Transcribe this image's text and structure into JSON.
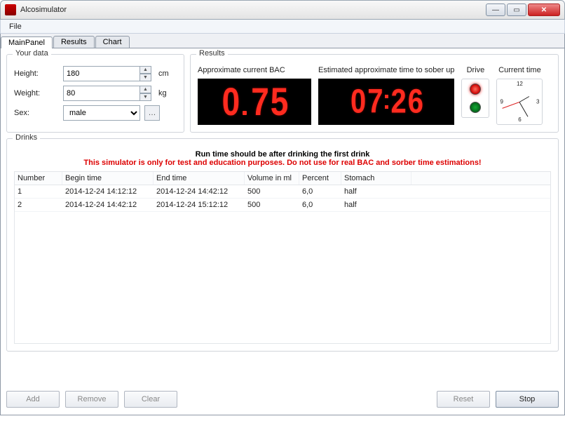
{
  "window": {
    "title": "Alcosimulator"
  },
  "menu": {
    "file": "File"
  },
  "tabs": {
    "main": "MainPanel",
    "results": "Results",
    "chart": "Chart"
  },
  "yourdata": {
    "legend": "Your data",
    "height_label": "Height:",
    "height_value": "180",
    "height_unit": "cm",
    "weight_label": "Weight:",
    "weight_value": "80",
    "weight_unit": "kg",
    "sex_label": "Sex:",
    "sex_value": "male"
  },
  "results": {
    "legend": "Results",
    "bac_caption": "Approximate current BAC",
    "bac_digits": [
      "0",
      "7",
      "5"
    ],
    "sober_caption": "Estimated approximate time to sober up",
    "sober_digits": [
      "0",
      "7",
      "2",
      "6"
    ],
    "drive_caption": "Drive",
    "clock_caption": "Current time"
  },
  "drinks": {
    "legend": "Drinks",
    "notice1": "Run time should be after drinking the first drink",
    "notice2": "This simulator is only for test and education purposes. Do not use for real BAC and sorber time estimations!",
    "columns": {
      "number": "Number",
      "begin": "Begin time",
      "end": "End time",
      "volume": "Volume in ml",
      "percent": "Percent",
      "stomach": "Stomach"
    },
    "rows": [
      {
        "number": "1",
        "begin": "2014-12-24 14:12:12",
        "end": "2014-12-24 14:42:12",
        "volume": "500",
        "percent": "6,0",
        "stomach": "half"
      },
      {
        "number": "2",
        "begin": "2014-12-24 14:42:12",
        "end": "2014-12-24 15:12:12",
        "volume": "500",
        "percent": "6,0",
        "stomach": "half"
      }
    ]
  },
  "buttons": {
    "add": "Add",
    "remove": "Remove",
    "clear": "Clear",
    "reset": "Reset",
    "stop": "Stop"
  }
}
